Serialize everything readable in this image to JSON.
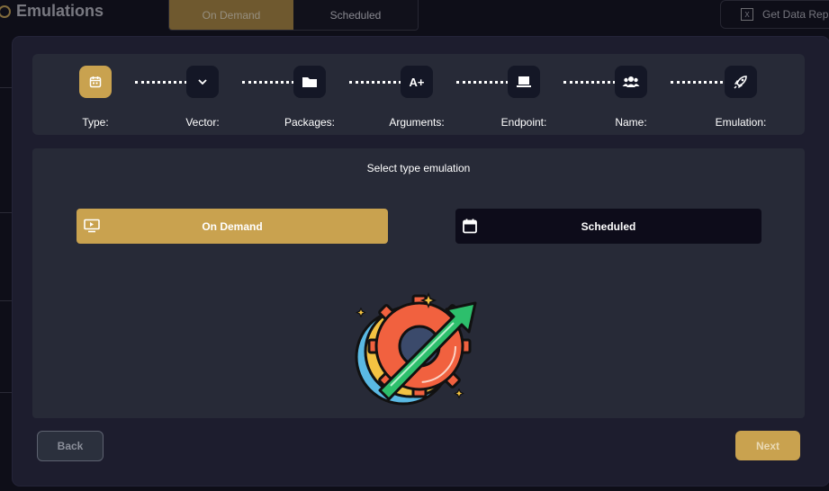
{
  "app": {
    "title": "Emulations"
  },
  "header_tabs": [
    {
      "label": "On Demand",
      "active": true
    },
    {
      "label": "Scheduled",
      "active": false
    }
  ],
  "report_button": {
    "label": "Get Data Rep"
  },
  "wizard": {
    "steps": [
      {
        "label": "Type:",
        "icon": "calendar-icon",
        "active": true
      },
      {
        "label": "Vector:",
        "icon": "chevron-down-icon",
        "active": false
      },
      {
        "label": "Packages:",
        "icon": "folder-icon",
        "active": false
      },
      {
        "label": "Arguments:",
        "icon": "a-plus-icon",
        "icon_text": "A+",
        "active": false
      },
      {
        "label": "Endpoint:",
        "icon": "laptop-icon",
        "active": false
      },
      {
        "label": "Name:",
        "icon": "users-icon",
        "active": false
      },
      {
        "label": "Emulation:",
        "icon": "rocket-icon",
        "active": false
      }
    ],
    "panel_title": "Select type emulation",
    "options": [
      {
        "label": "On Demand",
        "icon": "screen-play-icon",
        "selected": true
      },
      {
        "label": "Scheduled",
        "icon": "calendar-icon",
        "selected": false
      }
    ],
    "back_label": "Back",
    "next_label": "Next"
  },
  "colors": {
    "accent": "#c9a24f",
    "modal_bg": "#1d1d2e",
    "panel_bg": "#272a37",
    "dark_box": "#141726"
  }
}
